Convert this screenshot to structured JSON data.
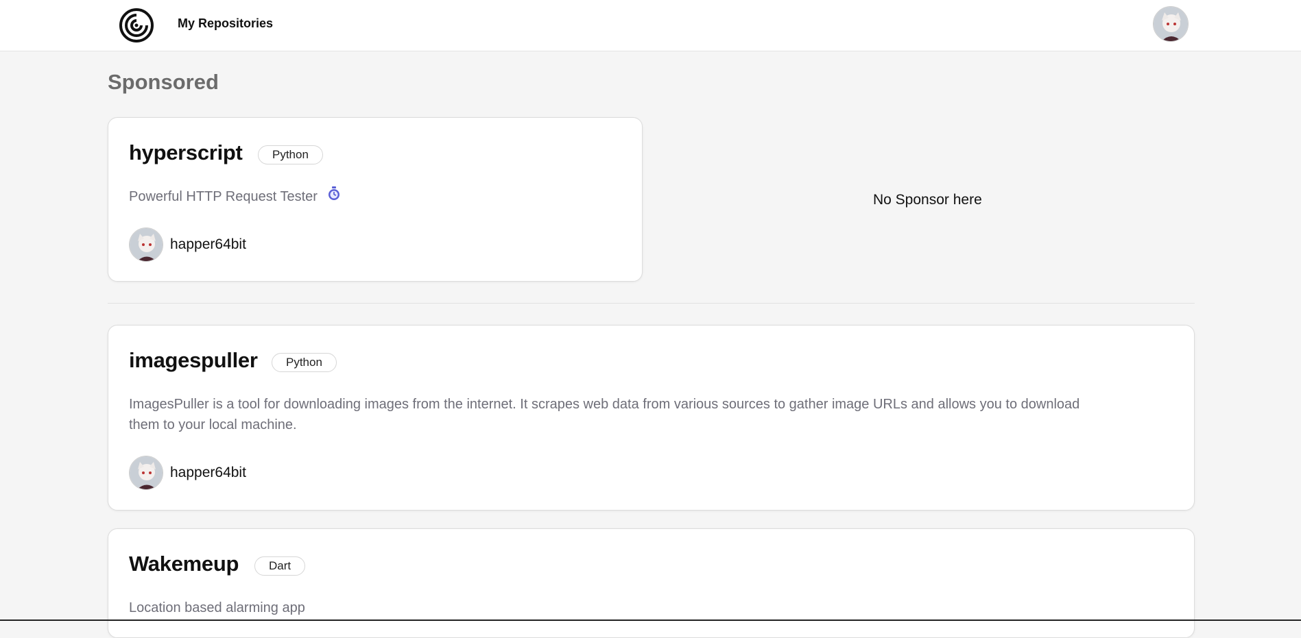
{
  "header": {
    "logo_icon": "spiral-logo-icon",
    "nav_label": "My Repositories",
    "avatar_icon": "user-avatar-icon"
  },
  "sponsored": {
    "section_title": "Sponsored",
    "empty_text": "No Sponsor here",
    "card": {
      "name": "hyperscript",
      "language": "Python",
      "description": "Powerful HTTP Request Tester",
      "description_icon": "stopwatch-icon",
      "owner": "happer64bit"
    }
  },
  "repositories": [
    {
      "name": "imagespuller",
      "language": "Python",
      "description_line1": "ImagesPuller is a tool for downloading images from the internet. It scrapes web data from various sources to gather image URLs and allows you to download",
      "description_line2": "them to your local machine.",
      "owner": "happer64bit"
    },
    {
      "name": "Wakemeup",
      "language": "Dart",
      "description": "Location based alarming app"
    }
  ],
  "colors": {
    "background": "#f5f5f5",
    "card": "#ffffff",
    "muted_text": "#6e6e78",
    "section_title": "#6b6b6b"
  }
}
